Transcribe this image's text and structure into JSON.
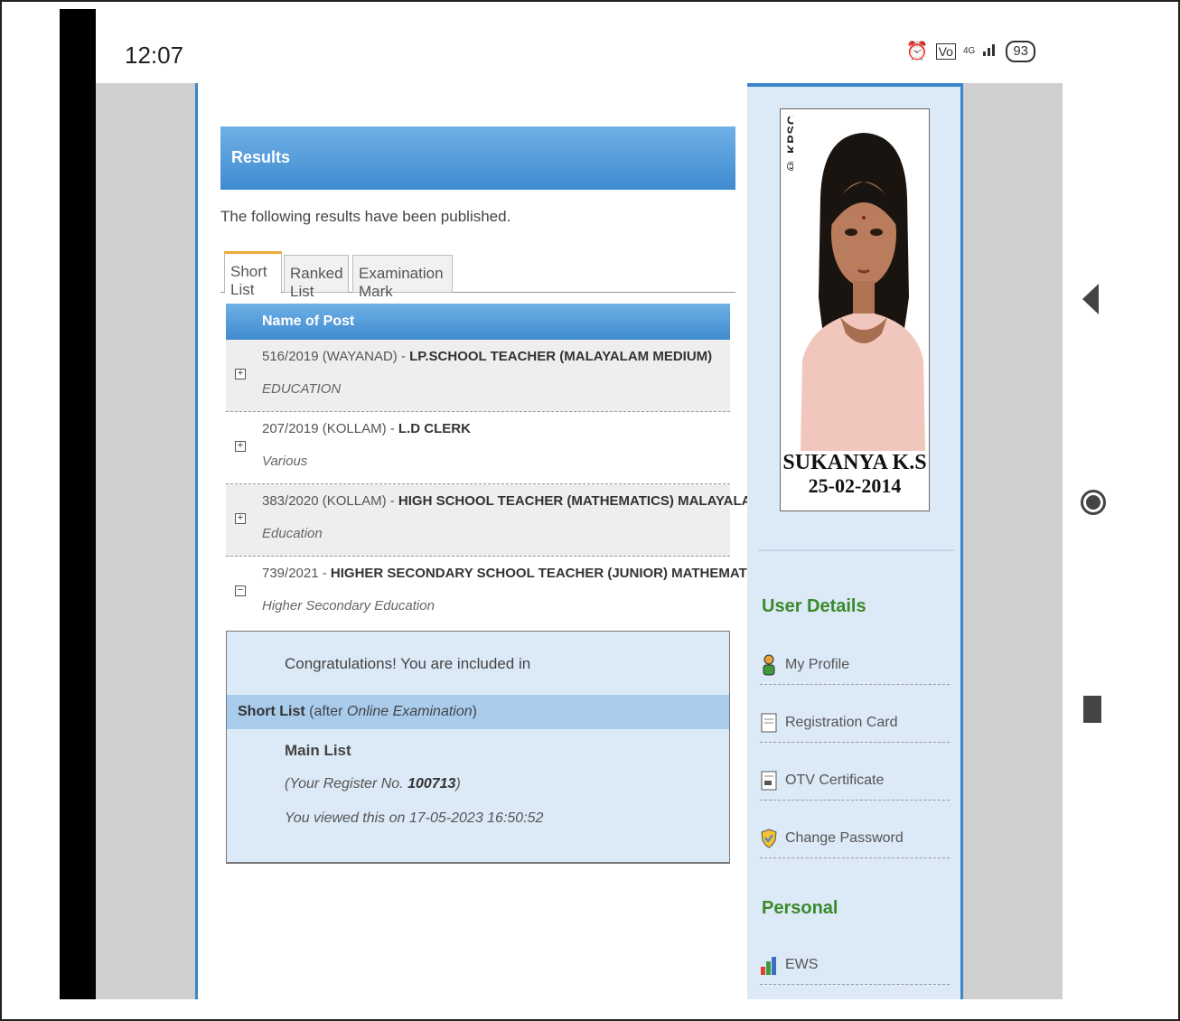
{
  "status_bar": {
    "time": "12:07",
    "battery": "93",
    "network": "4G",
    "icons": [
      "alarm-icon",
      "volte-icon",
      "signal-icon",
      "battery-icon"
    ]
  },
  "results": {
    "header": "Results",
    "intro": "The following results have been published.",
    "tabs": [
      "Short List",
      "Ranked List",
      "Examination Mark"
    ],
    "active_tab": "Short List",
    "column_header": "Name of Post",
    "rows": [
      {
        "code": "516/2019 (WAYANAD) - ",
        "title": "LP.SCHOOL TEACHER (MALAYALAM MEDIUM)",
        "department": "EDUCATION",
        "toggle": "+"
      },
      {
        "code": "207/2019 (KOLLAM) - ",
        "title": "L.D CLERK",
        "department": "Various",
        "toggle": "+"
      },
      {
        "code": "383/2020 (KOLLAM) - ",
        "title": "HIGH SCHOOL TEACHER (MATHEMATICS) MALAYALAM MEDIUM",
        "department": "Education",
        "toggle": "+"
      },
      {
        "code": "739/2021 - ",
        "title": "HIGHER SECONDARY SCHOOL TEACHER (JUNIOR) MATHEMATICS",
        "department": "Higher Secondary Education",
        "toggle": "−"
      }
    ],
    "detail": {
      "congrats": "Congratulations! You are included in",
      "list_name": "Short List",
      "list_qualifier_prefix": " (after ",
      "list_qualifier_italic": "Online Examination",
      "list_qualifier_suffix": ")",
      "main_list": "Main List",
      "register_prefix": "(Your Register No. ",
      "register_no": "100713",
      "register_suffix": ")",
      "viewed": "You viewed this on 17-05-2023 16:50:52"
    }
  },
  "profile": {
    "watermark": "© KPSC",
    "name": "SUKANYA K.S",
    "date": "25-02-2014"
  },
  "sidebar": {
    "user_details_title": "User Details",
    "user_links": [
      {
        "label": "My Profile",
        "icon": "person-icon"
      },
      {
        "label": "Registration Card",
        "icon": "card-icon"
      },
      {
        "label": "OTV Certificate",
        "icon": "certificate-icon"
      },
      {
        "label": "Change Password",
        "icon": "shield-icon"
      }
    ],
    "personal_title": "Personal",
    "personal_links": [
      {
        "label": "EWS",
        "icon": "bar-chart-icon"
      }
    ]
  },
  "nav_buttons": [
    "back-icon",
    "home-icon",
    "recents-icon"
  ],
  "colors": {
    "header_blue": "#3f8bd0",
    "sidebar_bg": "#dce9f7",
    "section_green": "#3a8a2a",
    "tab_accent": "#f0a93a"
  }
}
